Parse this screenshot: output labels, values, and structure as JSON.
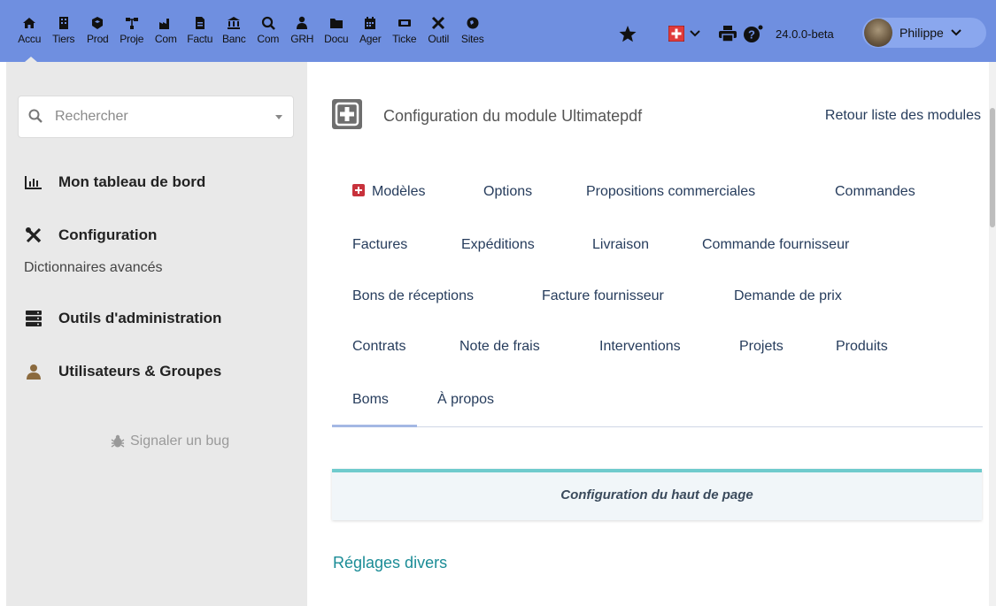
{
  "topbar": {
    "bg_color": "#6f8fe0",
    "menu": [
      {
        "label": "Accu",
        "icon": "home-icon"
      },
      {
        "label": "Tiers",
        "icon": "building-icon"
      },
      {
        "label": "Prod",
        "icon": "cube-icon"
      },
      {
        "label": "Proje",
        "icon": "project-icon"
      },
      {
        "label": "Com",
        "icon": "industry-icon"
      },
      {
        "label": "Factu",
        "icon": "invoice-icon"
      },
      {
        "label": "Banc",
        "icon": "bank-icon"
      },
      {
        "label": "Com",
        "icon": "search-dollar-icon"
      },
      {
        "label": "GRH",
        "icon": "user-tie-icon"
      },
      {
        "label": "Docu",
        "icon": "folder-icon"
      },
      {
        "label": "Ager",
        "icon": "calendar-icon"
      },
      {
        "label": "Ticke",
        "icon": "ticket-icon"
      },
      {
        "label": "Outil",
        "icon": "tools-icon"
      },
      {
        "label": "Sites",
        "icon": "globe-icon"
      }
    ],
    "version": "24.0.0-beta",
    "user_name": "Philippe"
  },
  "sidebar": {
    "search_placeholder": "Rechercher",
    "items": [
      {
        "label": "Mon tableau de bord",
        "icon": "dashboard-icon"
      },
      {
        "label": "Configuration",
        "icon": "tools-icon"
      },
      {
        "label": "Outils d'administration",
        "icon": "server-icon"
      },
      {
        "label": "Utilisateurs & Groupes",
        "icon": "user-icon"
      }
    ],
    "sub_item": "Dictionnaires avancés",
    "bug_link": "Signaler un bug"
  },
  "main": {
    "title": "Configuration du module Ultimatepdf",
    "back_link": "Retour liste des modules",
    "tabs": [
      "Modèles",
      "Options",
      "Propositions commerciales",
      "Commandes",
      "Factures",
      "Expéditions",
      "Livraison",
      "Commande fournisseur",
      "Bons de réceptions",
      "Facture fournisseur",
      "Demande de prix",
      "Contrats",
      "Note de frais",
      "Interventions",
      "Projets",
      "Produits",
      "Boms",
      "À propos"
    ],
    "active_tab": "Boms",
    "section_title": "Configuration du haut de page",
    "sub_heading": "Réglages divers",
    "accent_color": "#1a8c96"
  }
}
